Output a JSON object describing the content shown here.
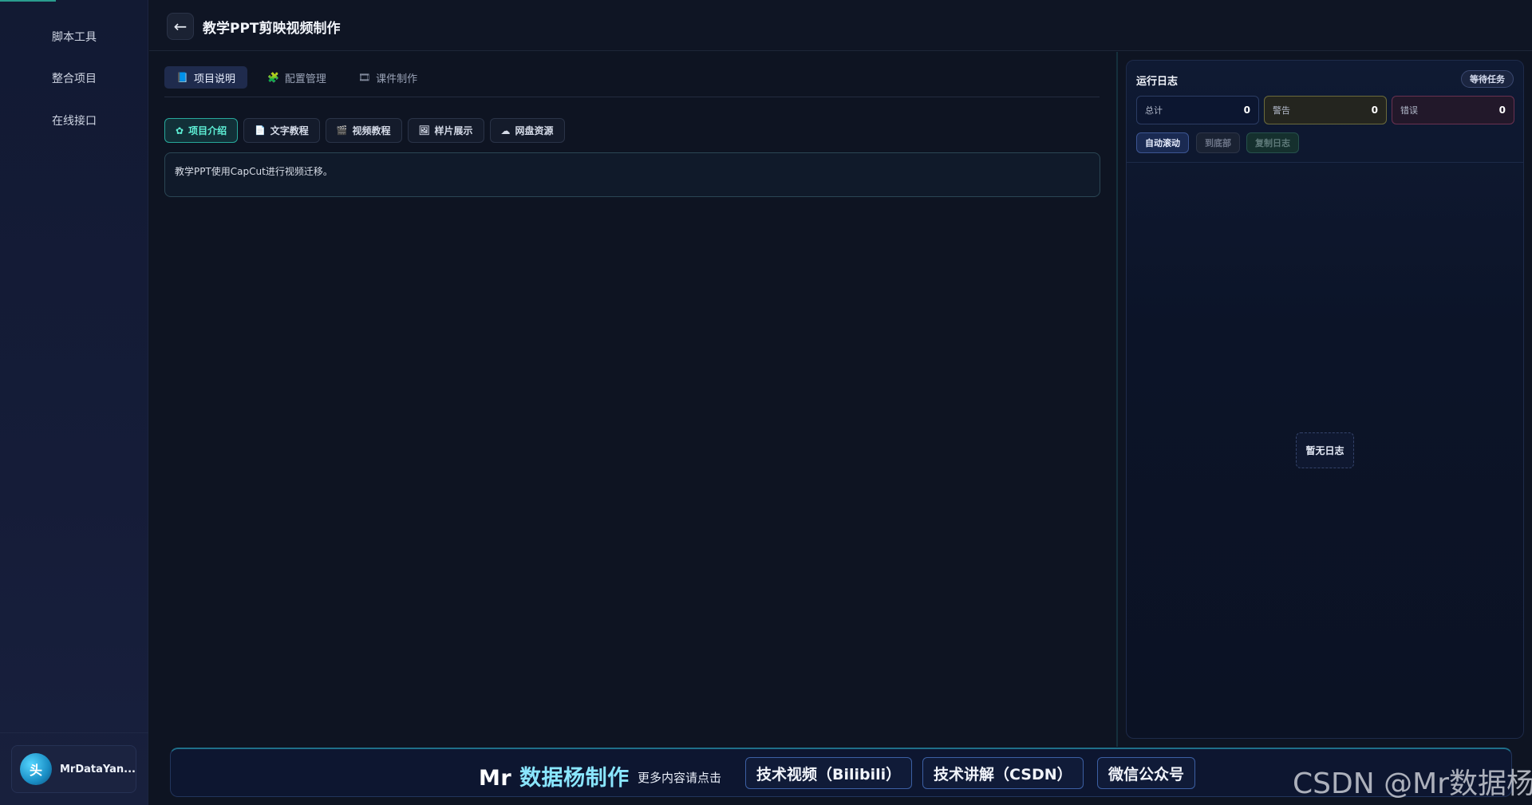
{
  "sidebar": {
    "items": [
      {
        "label": "脚本工具"
      },
      {
        "label": "整合项目"
      },
      {
        "label": "在线接口"
      }
    ],
    "user": {
      "avatar_text": "头",
      "name": "MrDataYan..."
    }
  },
  "header": {
    "back_icon": "←",
    "title": "教学PPT剪映视频制作"
  },
  "tabs": [
    {
      "icon": "📘",
      "label": "项目说明",
      "active": true
    },
    {
      "icon": "🧩",
      "label": "配置管理",
      "active": false
    },
    {
      "icon": "🎞",
      "label": "课件制作",
      "active": false
    }
  ],
  "sub_tabs": [
    {
      "icon": "✿",
      "label": "项目介绍",
      "active": true
    },
    {
      "icon": "📄",
      "label": "文字教程",
      "active": false
    },
    {
      "icon": "🎬",
      "label": "视频教程",
      "active": false
    },
    {
      "icon": "🖼",
      "label": "样片展示",
      "active": false
    },
    {
      "icon": "☁",
      "label": "网盘资源",
      "active": false
    }
  ],
  "intro": {
    "text": "教学PPT使用CapCut进行视频迁移。"
  },
  "log": {
    "title": "运行日志",
    "status_badge": "等待任务",
    "stats": {
      "total": {
        "label": "总计",
        "value": "0"
      },
      "warn": {
        "label": "警告",
        "value": "0"
      },
      "error": {
        "label": "错误",
        "value": "0"
      }
    },
    "buttons": {
      "auto_scroll": "自动滚动",
      "to_bottom": "到底部",
      "copy": "复制日志"
    },
    "empty_text": "暂无日志"
  },
  "footer": {
    "brand_prefix": "Mr",
    "brand_name": "数据杨制作",
    "more_text": "更多内容请点击",
    "links": [
      {
        "label": "技术视频（Bilibili）"
      },
      {
        "label": "技术讲解（CSDN）"
      },
      {
        "label": "微信公众号"
      }
    ]
  },
  "watermark": "CSDN @Mr数据杨",
  "colors": {
    "accent_teal": "#27a89b",
    "active_tab_bg": "#1f2b4d",
    "brand_cyan": "#8ae6ff"
  }
}
